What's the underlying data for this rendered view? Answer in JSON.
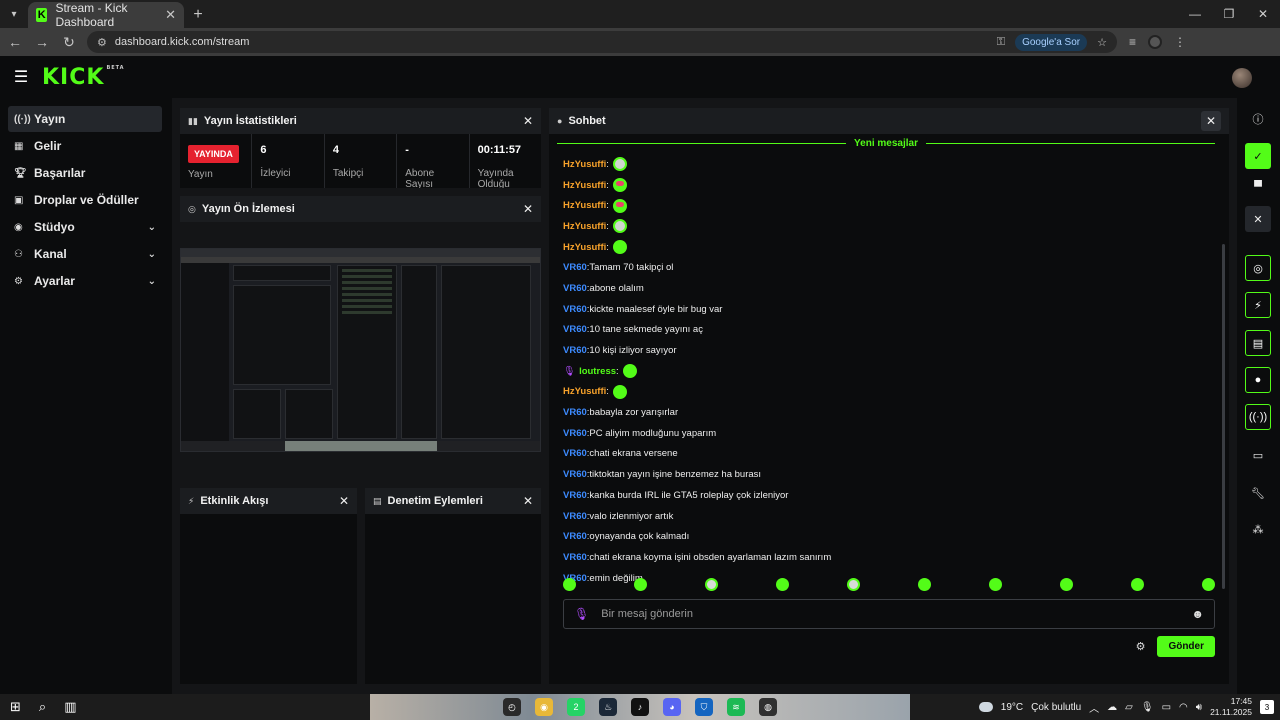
{
  "browser": {
    "tab_title": "Stream - Kick Dashboard",
    "favicon": "K",
    "url": "dashboard.kick.com/stream",
    "google_ask": "Google'a Sor"
  },
  "header": {
    "logo": "KICK",
    "logo_sup": "BETA"
  },
  "sidebar": {
    "items": [
      {
        "label": "Yayın",
        "icon": "broadcast-icon",
        "active": true
      },
      {
        "label": "Gelir",
        "icon": "revenue-icon"
      },
      {
        "label": "Başarılar",
        "icon": "trophy-icon"
      },
      {
        "label": "Droplar ve Ödüller",
        "icon": "gift-icon"
      },
      {
        "label": "Stüdyo",
        "icon": "studio-icon",
        "expandable": true
      },
      {
        "label": "Kanal",
        "icon": "channel-icon",
        "expandable": true
      },
      {
        "label": "Ayarlar",
        "icon": "settings-icon",
        "expandable": true
      }
    ]
  },
  "stats_panel": {
    "title": "Yayın İstatistikleri",
    "live_badge": "YAYINDA",
    "stats": [
      {
        "value": "",
        "label": "Yayın"
      },
      {
        "value": "6",
        "label": "İzleyici"
      },
      {
        "value": "4",
        "label": "Takipçi"
      },
      {
        "value": "-",
        "label": "Abone Sayısı"
      },
      {
        "value": "00:11:57",
        "label": "Yayında Olduğu"
      }
    ]
  },
  "preview_panel": {
    "title": "Yayın Ön İzlemesi"
  },
  "activity_panel": {
    "title": "Etkinlik Akışı"
  },
  "moderation_panel": {
    "title": "Denetim Eylemleri"
  },
  "chat": {
    "title": "Sohbet",
    "new_messages": "Yeni mesajlar",
    "messages": [
      {
        "user": "HzYusuffi",
        "color": "#f7a22b",
        "text": "",
        "emote": "gray"
      },
      {
        "user": "HzYusuffi",
        "color": "#f7a22b",
        "text": "",
        "emote": "pink"
      },
      {
        "user": "HzYusuffi",
        "color": "#f7a22b",
        "text": "",
        "emote": "pink"
      },
      {
        "user": "HzYusuffi",
        "color": "#f7a22b",
        "text": "",
        "emote": "gray"
      },
      {
        "user": "HzYusuffi",
        "color": "#f7a22b",
        "text": "",
        "emote": "green"
      },
      {
        "user": "VR60",
        "color": "#3d8bff",
        "text": "Tamam 70 takipçi ol"
      },
      {
        "user": "VR60",
        "color": "#3d8bff",
        "text": "abone olalım"
      },
      {
        "user": "VR60",
        "color": "#3d8bff",
        "text": "kickte maalesef öyle bir bug var"
      },
      {
        "user": "VR60",
        "color": "#3d8bff",
        "text": "10 tane sekmede yayını aç"
      },
      {
        "user": "VR60",
        "color": "#3d8bff",
        "text": "10 kişi izliyor sayıyor"
      },
      {
        "user": "loutress",
        "color": "#53fc18",
        "text": "",
        "emote": "green",
        "mic": true
      },
      {
        "user": "HzYusuffi",
        "color": "#f7a22b",
        "text": "",
        "emote": "green"
      },
      {
        "user": "VR60",
        "color": "#3d8bff",
        "text": "babayla zor yarışırlar"
      },
      {
        "user": "VR60",
        "color": "#3d8bff",
        "text": "PC aliyim modluğunu yaparım"
      },
      {
        "user": "VR60",
        "color": "#3d8bff",
        "text": "chati ekrana versene"
      },
      {
        "user": "VR60",
        "color": "#3d8bff",
        "text": "tiktoktan yayın işine benzemez ha burası"
      },
      {
        "user": "VR60",
        "color": "#3d8bff",
        "text": "kanka burda IRL ile GTA5 roleplay çok izleniyor"
      },
      {
        "user": "VR60",
        "color": "#3d8bff",
        "text": "valo izlenmiyor artık"
      },
      {
        "user": "VR60",
        "color": "#3d8bff",
        "text": "oynayanda çok kalmadı"
      },
      {
        "user": "VR60",
        "color": "#3d8bff",
        "text": "chati ekrana koyma işini obsden ayarlaman lazım sanırım"
      },
      {
        "user": "VR60",
        "color": "#3d8bff",
        "text": "emin değilim"
      }
    ],
    "emote_bar": [
      "green",
      "green",
      "gray",
      "green",
      "gray",
      "green",
      "green",
      "green",
      "green",
      "pink"
    ],
    "input_placeholder": "Bir mesaj gönderin",
    "send_label": "Gönder"
  },
  "rail_icons": [
    "info-icon",
    "check-icon",
    "layout-icon",
    "close-icon",
    "camera-icon",
    "bolt-icon",
    "document-icon",
    "chat-icon",
    "broadcast-icon",
    "printer-icon",
    "wrench-icon",
    "integrations-icon"
  ],
  "taskbar": {
    "weather": "19°C",
    "weather_text": "Çok bulutlu",
    "time": "17:45",
    "date": "21.11.2025",
    "notif_count": "3",
    "app_badge": "2"
  },
  "colors": {
    "accent": "#53fc18",
    "live": "#e5222f",
    "vr60": "#3d8bff",
    "hzyusuffi": "#f7a22b"
  }
}
